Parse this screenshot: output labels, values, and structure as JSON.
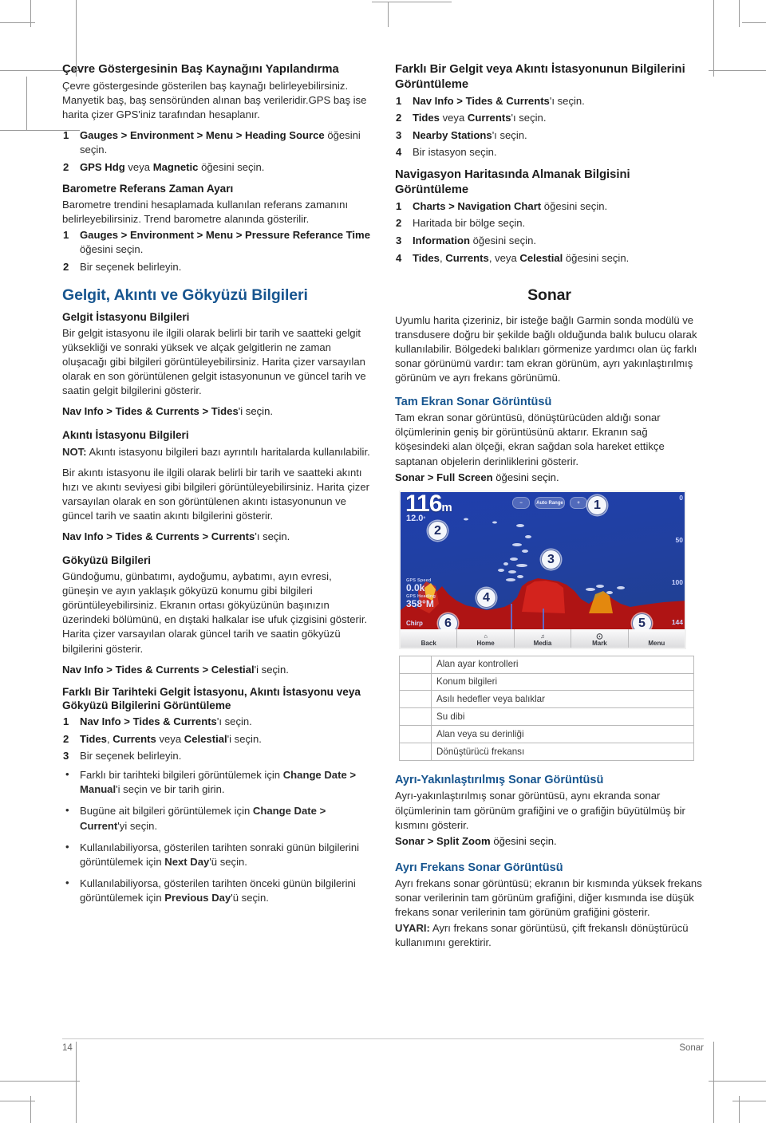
{
  "footer": {
    "page_number": "14",
    "section": "Sonar"
  },
  "left_column": {
    "heading1": "Çevre Göstergesinin Baş Kaynağını Yapılandırma",
    "para1": "Çevre göstergesinde gösterilen baş kaynağı belirleyebilirsiniz. Manyetik baş, baş sensöründen alınan baş verileridir.GPS baş ise harita çizer GPS'iniz tarafından hesaplanır.",
    "steps1": [
      {
        "bold": "Gauges > Environment > Menu > Heading Source",
        "rest": " öğesini seçin."
      },
      {
        "bold": "GPS Hdg",
        "mid": " veya ",
        "bold2": "Magnetic",
        "rest": " öğesini seçin."
      }
    ],
    "heading2": "Barometre Referans Zaman Ayarı",
    "para2": "Barometre trendini hesaplamada kullanılan referans zamanını belirleyebilirsiniz. Trend barometre alanında gösterilir.",
    "steps2": [
      {
        "bold": "Gauges > Environment > Menu > Pressure Referance Time",
        "rest": " öğesini seçin."
      },
      {
        "plain": "Bir seçenek belirleyin."
      }
    ],
    "chapter_title": "Gelgit, Akıntı ve Gökyüzü Bilgileri",
    "sub1_title": "Gelgit İstasyonu Bilgileri",
    "sub1_para": "Bir gelgit istasyonu ile ilgili olarak belirli bir tarih ve saatteki gelgit yüksekliği ve sonraki yüksek ve alçak gelgitlerin ne zaman oluşacağı gibi bilgileri görüntüleyebilirsiniz. Harita çizer varsayılan olarak en son görüntülenen gelgit istasyonunun ve güncel tarih ve saatin gelgit bilgilerini gösterir.",
    "sub1_cmd_bold": "Nav Info > Tides & Currents > Tides",
    "sub1_cmd_rest": "'i seçin.",
    "sub2_title": "Akıntı İstasyonu Bilgileri",
    "sub2_note_label": "NOT:",
    "sub2_note": " Akıntı istasyonu bilgileri bazı ayrıntılı haritalarda kullanılabilir.",
    "sub2_para": "Bir akıntı istasyonu ile ilgili olarak belirli bir tarih ve saatteki akıntı hızı ve akıntı seviyesi gibi bilgileri görüntüleyebilirsiniz. Harita çizer varsayılan olarak en son görüntülenen akıntı istasyonunun ve güncel tarih ve saatin akıntı bilgilerini gösterir.",
    "sub2_cmd_bold": "Nav Info > Tides & Currents > Currents",
    "sub2_cmd_rest": "'ı seçin.",
    "sub3_title": "Gökyüzü Bilgileri",
    "sub3_para": "Gündoğumu, günbatımı, aydoğumu, aybatımı, ayın evresi, güneşin ve ayın yaklaşık gökyüzü konumu gibi bilgileri görüntüleyebilirsiniz. Ekranın ortası gökyüzünün başınızın üzerindeki bölümünü, en dıştaki halkalar ise ufuk çizgisini gösterir. Harita çizer varsayılan olarak güncel tarih ve saatin gökyüzü bilgilerini gösterir.",
    "sub3_cmd_bold": "Nav Info > Tides & Currents > Celestial",
    "sub3_cmd_rest": "'i seçin.",
    "sub4_title": "Farklı Bir Tarihteki Gelgit İstasyonu, Akıntı İstasyonu veya Gökyüzü Bilgilerini Görüntüleme",
    "steps4": [
      {
        "bold": "Nav Info > Tides & Currents",
        "rest": "'ı seçin."
      },
      {
        "bold": "Tides",
        "mid": ", ",
        "bold2": "Currents",
        "mid2": " veya ",
        "bold3": "Celestial",
        "rest": "'i seçin."
      },
      {
        "plain": "Bir seçenek belirleyin."
      }
    ],
    "bullets4": [
      {
        "pre": "Farklı bir tarihteki bilgileri görüntülemek için ",
        "bold": "Change Date > Manual",
        "post": "'i seçin ve bir tarih girin."
      },
      {
        "pre": "Bugüne ait bilgileri görüntülemek için ",
        "bold": "Change Date > Current",
        "post": "'yi seçin."
      },
      {
        "pre": "Kullanılabiliyorsa, gösterilen tarihten sonraki günün bilgilerini görüntülemek için ",
        "bold": "Next Day",
        "post": "'ü seçin."
      },
      {
        "pre": "Kullanılabiliyorsa, gösterilen tarihten önceki günün bilgilerini görüntülemek için ",
        "bold": "Previous Day",
        "post": "'ü seçin."
      }
    ]
  },
  "right_column": {
    "heading1": "Farklı Bir Gelgit veya Akıntı İstasyonunun Bilgilerini Görüntüleme",
    "steps1": [
      {
        "bold": "Nav Info > Tides & Currents",
        "rest": "'ı seçin."
      },
      {
        "bold": "Tides",
        "mid": " veya ",
        "bold2": "Currents",
        "rest": "'ı seçin."
      },
      {
        "bold": "Nearby Stations",
        "rest": "'ı seçin."
      },
      {
        "plain": "Bir istasyon seçin."
      }
    ],
    "heading2": "Navigasyon Haritasında Almanak Bilgisini Görüntüleme",
    "steps2": [
      {
        "bold": "Charts > Navigation Chart",
        "rest": " öğesini seçin."
      },
      {
        "plain": "Haritada bir bölge seçin."
      },
      {
        "bold": "Information",
        "rest": " öğesini seçin."
      },
      {
        "bold": "Tides",
        "mid": ", ",
        "bold2": "Currents",
        "mid2": ", veya ",
        "bold3": "Celestial",
        "rest": " öğesini seçin."
      }
    ],
    "chapter_title": "Sonar",
    "chapter_para": "Uyumlu harita çizeriniz, bir isteğe bağlı Garmin sonda modülü ve transdusere doğru bir şekilde bağlı olduğunda balık bulucu olarak kullanılabilir. Bölgedeki balıkları görmenize yardımcı olan üç farklı sonar görünümü vardır: tam ekran görünüm, ayrı yakınlaştırılmış görünüm ve ayrı frekans görünümü.",
    "sub1_title": "Tam Ekran Sonar Görüntüsü",
    "sub1_para": "Tam ekran sonar görüntüsü, dönüştürücüden aldığı sonar ölçümlerinin geniş bir görüntüsünü aktarır. Ekranın sağ köşesindeki alan ölçeği, ekran sağdan sola hareket ettikçe saptanan objelerin derinliklerini gösterir.",
    "sub1_cmd_bold": "Sonar > Full Screen",
    "sub1_cmd_rest": " öğesini seçin.",
    "sonar_screenshot": {
      "depth_value": "116",
      "depth_unit": "m",
      "temperature": "12.0",
      "temperature_unit": "°",
      "gps_speed_label": "GPS Speed",
      "gps_speed_value": "0.0k",
      "gps_heading_label": "GPS Heading",
      "gps_heading_value": "358°M",
      "frequency_label": "Chirp",
      "range_ticks": [
        "0",
        "50",
        "100",
        "144"
      ],
      "top_buttons": [
        "−",
        "Auto Range",
        "+"
      ],
      "softkeys": [
        {
          "label": "Back",
          "icon": ""
        },
        {
          "label": "Home",
          "icon": "home-icon"
        },
        {
          "label": "Media",
          "icon": "music-note-icon"
        },
        {
          "label": "Mark",
          "icon": "waypoint-icon"
        },
        {
          "label": "Menu",
          "icon": ""
        }
      ],
      "callouts": [
        "1",
        "2",
        "3",
        "4",
        "5",
        "6"
      ]
    },
    "legend_rows": [
      {
        "num": "",
        "text": "Alan ayar kontrolleri"
      },
      {
        "num": "",
        "text": "Konum bilgileri"
      },
      {
        "num": "",
        "text": "Asılı hedefler veya balıklar"
      },
      {
        "num": "",
        "text": "Su dibi"
      },
      {
        "num": "",
        "text": "Alan veya su derinliği"
      },
      {
        "num": "",
        "text": "Dönüştürücü frekansı"
      }
    ],
    "sub2_title": "Ayrı-Yakınlaştırılmış Sonar Görüntüsü",
    "sub2_para": "Ayrı-yakınlaştırılmış sonar görüntüsü, aynı ekranda sonar ölçümlerinin tam görünüm grafiğini ve o grafiğin büyütülmüş bir kısmını gösterir.",
    "sub2_cmd_bold": "Sonar > Split Zoom",
    "sub2_cmd_rest": " öğesini seçin.",
    "sub3_title": "Ayrı Frekans Sonar Görüntüsü",
    "sub3_para": "Ayrı frekans sonar görüntüsü; ekranın bir kısmında yüksek frekans sonar verilerinin tam görünüm grafiğini, diğer kısmında ise düşük frekans sonar verilerinin tam görünüm grafiğini gösterir.",
    "sub3_note_label": "UYARI:",
    "sub3_note": " Ayrı frekans sonar görüntüsü, çift frekanslı dönüştürücü kullanımını gerektirir."
  },
  "colors": {
    "heading_blue": "#17558f",
    "sonar_water": "#1f3fae",
    "sonar_return_red": "#c0201c",
    "sonar_return_yellow": "#f3c200"
  }
}
